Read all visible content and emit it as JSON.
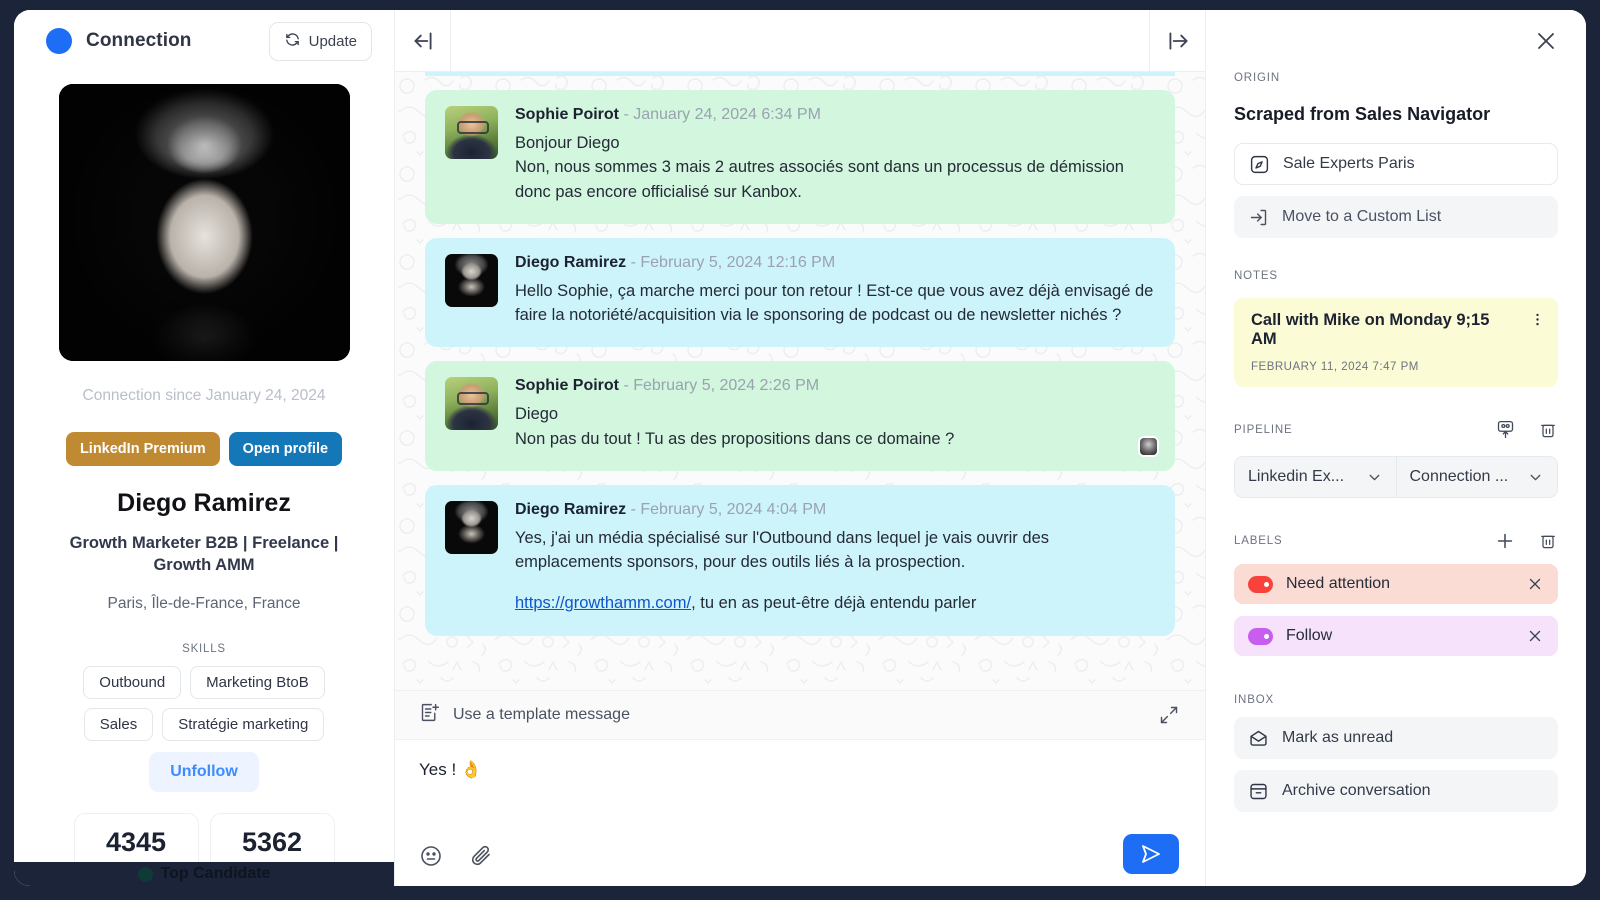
{
  "profile": {
    "header": {
      "status": "Connection",
      "update_label": "Update"
    },
    "avatar_name": "diego-photo",
    "connection_since": "Connection since January 24, 2024",
    "badges": {
      "premium": "LinkedIn Premium",
      "open_profile": "Open profile"
    },
    "name": "Diego Ramirez",
    "headline": "Growth Marketer B2B | Freelance | Growth AMM",
    "location": "Paris, Île-de-France, France",
    "skills_label": "SKILLS",
    "skills": [
      "Outbound",
      "Marketing BtoB",
      "Sales",
      "Stratégie marketing"
    ],
    "unfollow_label": "Unfollow",
    "stats": [
      "4345",
      "5362"
    ],
    "bottom_bar": "Top Candidate"
  },
  "conversation": {
    "messages": [
      {
        "sender": "Sophie Poirot",
        "separator": "-",
        "time": "January 24, 2024 6:34 PM",
        "side": "them",
        "avatar": "sophie",
        "lines": [
          "Bonjour Diego",
          "Non, nous sommes 3 mais 2 autres associés sont dans un processus de démission donc pas encore officialisé sur Kanbox."
        ]
      },
      {
        "sender": "Diego Ramirez",
        "separator": "-",
        "time": "February 5, 2024 12:16 PM",
        "side": "me",
        "avatar": "diego",
        "lines": [
          "Hello Sophie, ça marche merci pour ton retour ! Est-ce que vous avez déjà envisagé de faire la notoriété/acquisition via le sponsoring de podcast ou de newsletter nichés ?"
        ]
      },
      {
        "sender": "Sophie Poirot",
        "separator": "-",
        "time": "February 5, 2024 2:26 PM",
        "side": "them",
        "avatar": "sophie",
        "lines": [
          "Diego",
          "Non pas du tout ! Tu as des propositions dans ce domaine ?"
        ],
        "seen_indicator": true
      },
      {
        "sender": "Diego Ramirez",
        "separator": "-",
        "time": "February 5, 2024 4:04 PM",
        "side": "me",
        "avatar": "diego",
        "lines": [
          "Yes, j'ai un média spécialisé sur l'Outbound dans lequel je vais ouvrir des emplacements sponsors, pour des outils liés à la prospection."
        ],
        "link_text": "https://growthamm.com/",
        "link_tail": ", tu en as peut-être déjà entendu parler"
      }
    ]
  },
  "composer": {
    "template_label": "Use a template message",
    "draft_text": "Yes ! 👌",
    "emoji_icon": "emoji-icon",
    "attach_icon": "paperclip-icon",
    "send_icon": "send-icon",
    "expand_icon": "expand-icon"
  },
  "details": {
    "origin_label": "ORIGIN",
    "origin_title": "Scraped from Sales Navigator",
    "origin_source": "Sale Experts Paris",
    "move_list": "Move to a Custom List",
    "notes_label": "NOTES",
    "note": {
      "title": "Call with Mike on Monday 9;15 AM",
      "date": "FEBRUARY 11, 2024 7:47 PM"
    },
    "pipeline_label": "PIPELINE",
    "pipeline": {
      "left": "Linkedin Ex...",
      "right": "Connection ..."
    },
    "labels_label": "LABELS",
    "labels": [
      {
        "text": "Need attention",
        "color": "#f8423a",
        "bg": "#fbdcd4"
      },
      {
        "text": "Follow",
        "color": "#c75ef0",
        "bg": "#f7e2fb"
      }
    ],
    "inbox_label": "INBOX",
    "inbox": [
      "Mark as unread",
      "Archive conversation"
    ]
  },
  "colors": {
    "accent": "#1d6ef5",
    "bubble_them": "#d2f6de",
    "bubble_me": "#cdf4fb",
    "note_bg": "#fbfbd6",
    "app_bg": "#1b2438"
  }
}
